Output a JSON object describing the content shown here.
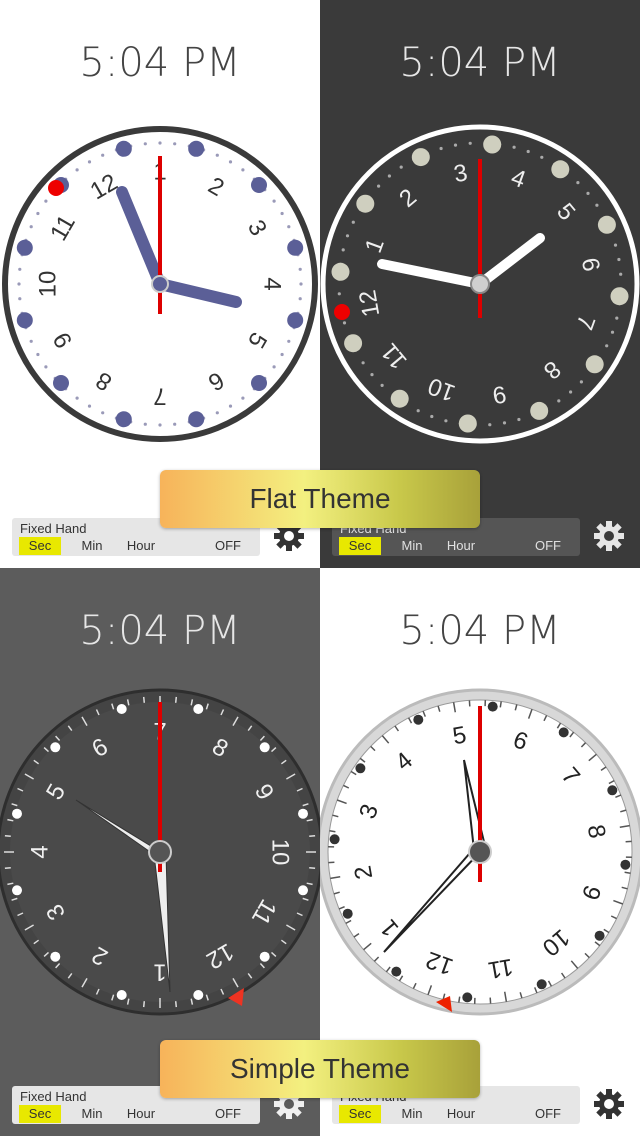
{
  "panels": [
    {
      "time": "5:04 PM",
      "control": {
        "label": "Fixed Hand",
        "options": [
          "Sec",
          "Min",
          "Hour",
          "OFF"
        ],
        "selected": "Sec"
      }
    },
    {
      "time": "5:04 PM",
      "control": {
        "label": "Fixed Hand",
        "options": [
          "Sec",
          "Min",
          "Hour",
          "OFF"
        ],
        "selected": "Sec"
      }
    },
    {
      "time": "5:04 PM",
      "control": {
        "label": "Fixed Hand",
        "options": [
          "Sec",
          "Min",
          "Hour",
          "OFF"
        ],
        "selected": "Sec"
      }
    },
    {
      "time": "5:04 PM",
      "control": {
        "label": "Fixed Hand",
        "options": [
          "Sec",
          "Min",
          "Hour",
          "OFF"
        ],
        "selected": "Sec"
      }
    }
  ],
  "banners": {
    "flat": "Flat Theme",
    "simple": "Simple Theme"
  },
  "clock_numerals": [
    "12",
    "1",
    "2",
    "3",
    "4",
    "5",
    "6",
    "7",
    "8",
    "9",
    "10",
    "11"
  ],
  "icons": {
    "settings": "gear-icon"
  },
  "colors": {
    "accent_red": "#dd0000",
    "selected_highlight": "#e8e800",
    "flat_dot": "#5b5f97"
  }
}
